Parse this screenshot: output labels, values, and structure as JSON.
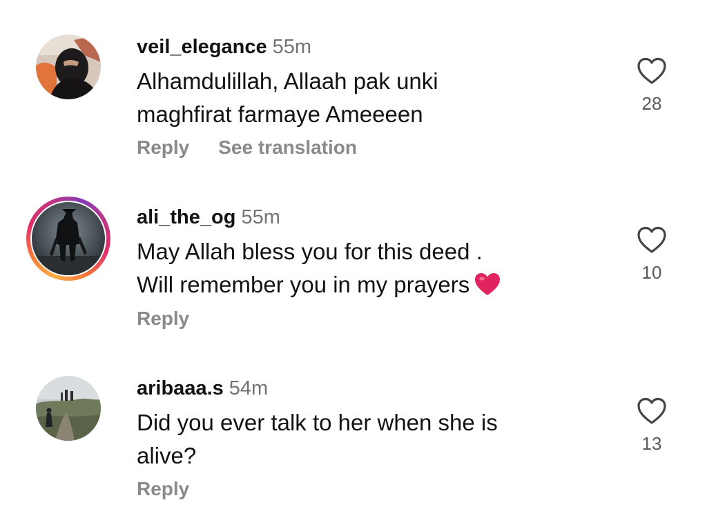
{
  "comments": [
    {
      "username": "veil_elegance",
      "time": "55m",
      "lines": [
        "Alhamdulillah, Allaah pak unki",
        "maghfirat farmaye Ameeeen"
      ],
      "reply_label": "Reply",
      "translate_label": "See translation",
      "likes": "28",
      "has_story_ring": false
    },
    {
      "username": "ali_the_og",
      "time": "55m",
      "lines": [
        "May Allah bless you for this deed .",
        "Will remember you in my prayers"
      ],
      "reply_label": "Reply",
      "likes": "10",
      "has_story_ring": true,
      "emoji": "red-heart-emoji"
    },
    {
      "username": "aribaaa.s",
      "time": "54m",
      "lines": [
        "Did you ever talk to her when she is",
        "alive?"
      ],
      "reply_label": "Reply",
      "likes": "13",
      "has_story_ring": false
    }
  ],
  "colors": {
    "text": "#121212",
    "secondary": "#737373",
    "action": "#8a8a8a",
    "heart_emoji": "#e0245e"
  },
  "icons": {
    "like": "heart-outline-icon"
  }
}
